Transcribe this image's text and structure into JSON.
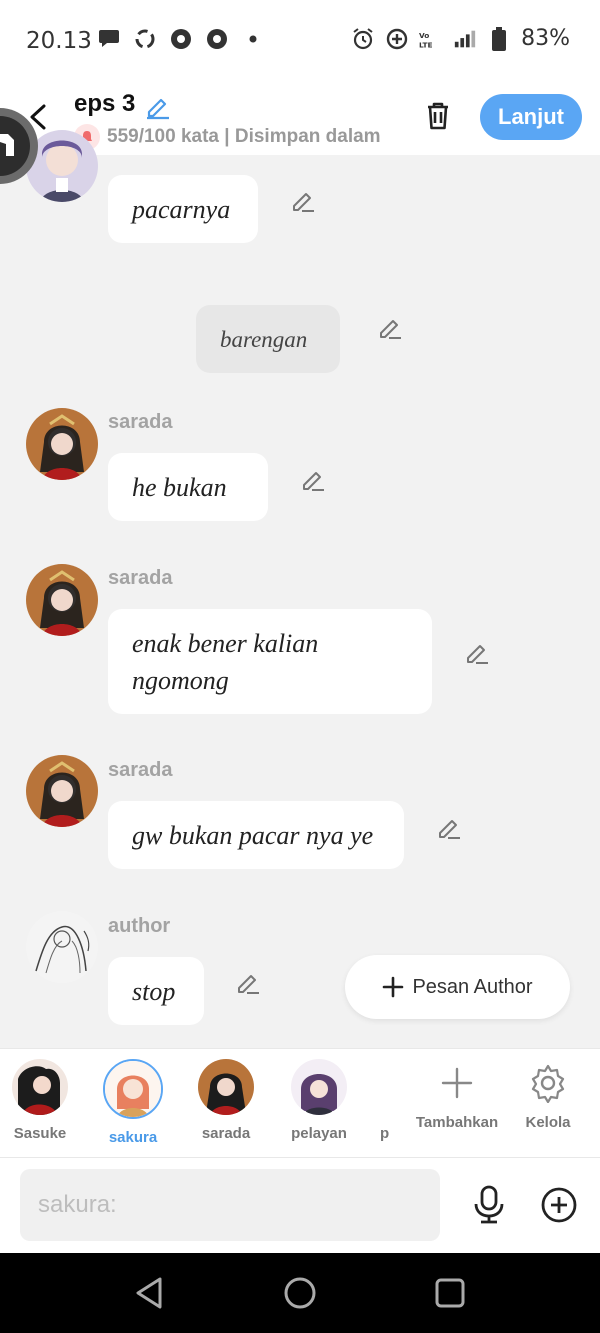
{
  "status_bar": {
    "time": "20.13",
    "battery": "83%",
    "left_icons": [
      "chat-bubble-icon",
      "sync-icon",
      "circle-play-icon",
      "circle-play-icon",
      "dot-icon"
    ],
    "right_icons": [
      "alarm-icon",
      "data-saver-icon",
      "volte-icon",
      "signal-icon",
      "battery-icon"
    ]
  },
  "header": {
    "title": "eps 3",
    "word_count": "559/100 kata | Disimpan dalam",
    "next_label": "Lanjut"
  },
  "messages": [
    {
      "sender": "",
      "text": "pacarnya"
    },
    {
      "sender": "",
      "text": "barengan",
      "narration": true
    },
    {
      "sender": "sarada",
      "text": "he bukan"
    },
    {
      "sender": "sarada",
      "text": "enak bener kalian ngomong"
    },
    {
      "sender": "sarada",
      "text": "gw bukan pacar nya ye"
    },
    {
      "sender": "author",
      "text": "stop"
    }
  ],
  "pesan_author_label": "Pesan Author",
  "characters": [
    {
      "name": "Sasuke"
    },
    {
      "name": "sakura",
      "selected": true
    },
    {
      "name": "sarada"
    },
    {
      "name": "pelayan"
    },
    {
      "name": "p"
    }
  ],
  "tools": {
    "add_label": "Tambahkan",
    "manage_label": "Kelola"
  },
  "input": {
    "placeholder": "sakura:"
  },
  "colors": {
    "accent": "#5aa6f4",
    "background": "#f2f2f2"
  }
}
